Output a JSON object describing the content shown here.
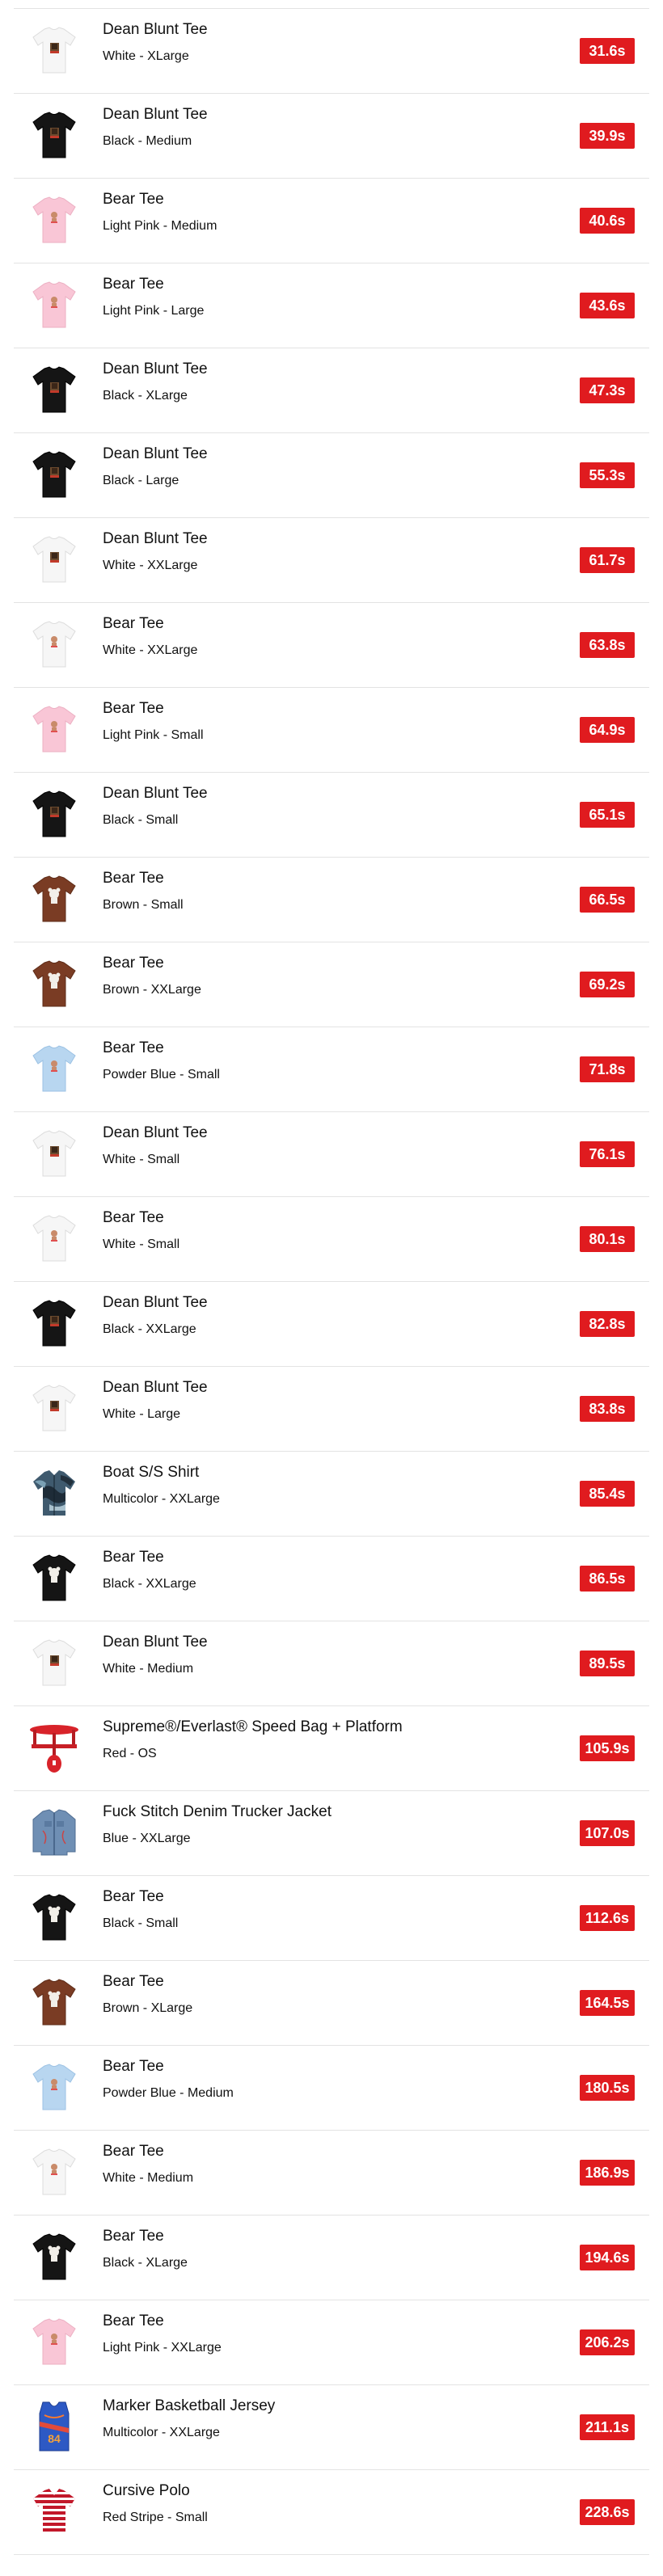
{
  "colors": {
    "badge": "#e01b1f"
  },
  "items": [
    {
      "name": "Dean Blunt Tee",
      "variant": "White - XLarge",
      "time": "31.6s",
      "icon": "tee-white-photo"
    },
    {
      "name": "Dean Blunt Tee",
      "variant": "Black - Medium",
      "time": "39.9s",
      "icon": "tee-black-photo"
    },
    {
      "name": "Bear Tee",
      "variant": "Light Pink - Medium",
      "time": "40.6s",
      "icon": "tee-pink-bear"
    },
    {
      "name": "Bear Tee",
      "variant": "Light Pink - Large",
      "time": "43.6s",
      "icon": "tee-pink-bear"
    },
    {
      "name": "Dean Blunt Tee",
      "variant": "Black - XLarge",
      "time": "47.3s",
      "icon": "tee-black-photo"
    },
    {
      "name": "Dean Blunt Tee",
      "variant": "Black - Large",
      "time": "55.3s",
      "icon": "tee-black-photo"
    },
    {
      "name": "Dean Blunt Tee",
      "variant": "White - XXLarge",
      "time": "61.7s",
      "icon": "tee-white-photo"
    },
    {
      "name": "Bear Tee",
      "variant": "White - XXLarge",
      "time": "63.8s",
      "icon": "tee-white-bear"
    },
    {
      "name": "Bear Tee",
      "variant": "Light Pink - Small",
      "time": "64.9s",
      "icon": "tee-pink-bear"
    },
    {
      "name": "Dean Blunt Tee",
      "variant": "Black - Small",
      "time": "65.1s",
      "icon": "tee-black-photo"
    },
    {
      "name": "Bear Tee",
      "variant": "Brown - Small",
      "time": "66.5s",
      "icon": "tee-brown-bear"
    },
    {
      "name": "Bear Tee",
      "variant": "Brown - XXLarge",
      "time": "69.2s",
      "icon": "tee-brown-bear"
    },
    {
      "name": "Bear Tee",
      "variant": "Powder Blue - Small",
      "time": "71.8s",
      "icon": "tee-blue-bear"
    },
    {
      "name": "Dean Blunt Tee",
      "variant": "White - Small",
      "time": "76.1s",
      "icon": "tee-white-photo"
    },
    {
      "name": "Bear Tee",
      "variant": "White - Small",
      "time": "80.1s",
      "icon": "tee-white-bear"
    },
    {
      "name": "Dean Blunt Tee",
      "variant": "Black - XXLarge",
      "time": "82.8s",
      "icon": "tee-black-photo"
    },
    {
      "name": "Dean Blunt Tee",
      "variant": "White - Large",
      "time": "83.8s",
      "icon": "tee-white-photo"
    },
    {
      "name": "Boat S/S Shirt",
      "variant": "Multicolor - XXLarge",
      "time": "85.4s",
      "icon": "shirt-camo"
    },
    {
      "name": "Bear Tee",
      "variant": "Black - XXLarge",
      "time": "86.5s",
      "icon": "tee-black-bear"
    },
    {
      "name": "Dean Blunt Tee",
      "variant": "White - Medium",
      "time": "89.5s",
      "icon": "tee-white-photo"
    },
    {
      "name": "Supreme®/Everlast® Speed Bag + Platform",
      "variant": "Red - OS",
      "time": "105.9s",
      "icon": "speed-bag"
    },
    {
      "name": "Fuck Stitch Denim Trucker Jacket",
      "variant": "Blue - XXLarge",
      "time": "107.0s",
      "icon": "denim-jacket"
    },
    {
      "name": "Bear Tee",
      "variant": "Black - Small",
      "time": "112.6s",
      "icon": "tee-black-bear"
    },
    {
      "name": "Bear Tee",
      "variant": "Brown - XLarge",
      "time": "164.5s",
      "icon": "tee-brown-bear"
    },
    {
      "name": "Bear Tee",
      "variant": "Powder Blue - Medium",
      "time": "180.5s",
      "icon": "tee-blue-bear"
    },
    {
      "name": "Bear Tee",
      "variant": "White - Medium",
      "time": "186.9s",
      "icon": "tee-white-bear"
    },
    {
      "name": "Bear Tee",
      "variant": "Black - XLarge",
      "time": "194.6s",
      "icon": "tee-black-bear"
    },
    {
      "name": "Bear Tee",
      "variant": "Light Pink - XXLarge",
      "time": "206.2s",
      "icon": "tee-pink-bear"
    },
    {
      "name": "Marker Basketball Jersey",
      "variant": "Multicolor - XXLarge",
      "time": "211.1s",
      "icon": "jersey"
    },
    {
      "name": "Cursive Polo",
      "variant": "Red Stripe - Small",
      "time": "228.6s",
      "icon": "polo-stripe"
    }
  ]
}
